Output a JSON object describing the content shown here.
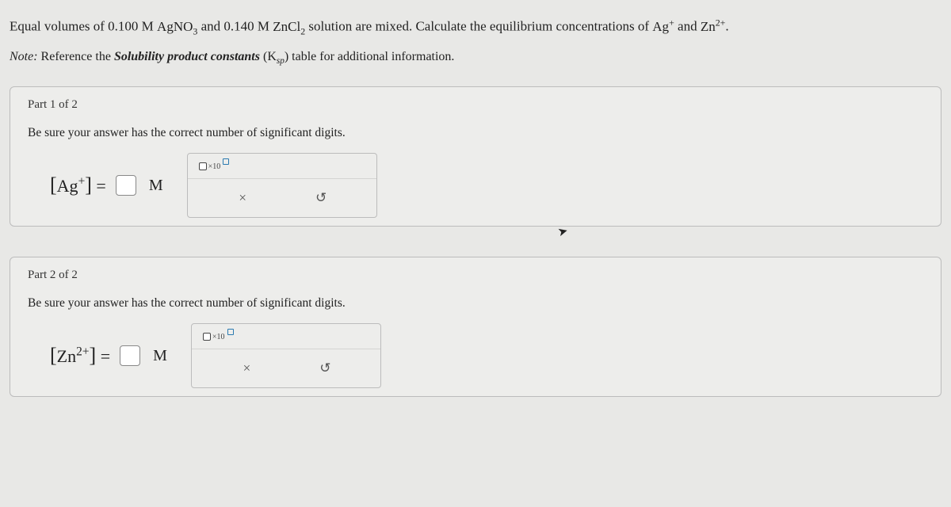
{
  "problem": {
    "prefix": "Equal volumes of ",
    "conc1": "0.100 M",
    "reagent1_a": "AgNO",
    "reagent1_sub": "3",
    "middle1": " and ",
    "conc2": "0.140 M",
    "reagent2_a": "ZnCl",
    "reagent2_sub": "2",
    "middle2": " solution are mixed. Calculate the equilibrium concentrations of ",
    "ion1": "Ag",
    "ion1_sup": "+",
    "and": " and ",
    "ion2": "Zn",
    "ion2_sup": "2+",
    "period": "."
  },
  "note": {
    "prefix": "Note:",
    "mid1": " Reference the ",
    "ref": "Solubility product constants",
    "k_open": " (K",
    "k_sub": "sp",
    "k_close": ")",
    "tail": " table for additional information."
  },
  "part1": {
    "label": "Part 1 of 2",
    "instruction": "Be sure your answer has the correct number of significant digits.",
    "ion": "Ag",
    "ion_sup": "+",
    "equals": " = ",
    "unit": "M",
    "toolbox_x10": "×10",
    "clear": "×",
    "reset": "↺"
  },
  "part2": {
    "label": "Part 2 of 2",
    "instruction": "Be sure your answer has the correct number of significant digits.",
    "ion": "Zn",
    "ion_sup": "2+",
    "equals": " = ",
    "unit": "M",
    "toolbox_x10": "×10",
    "clear": "×",
    "reset": "↺"
  }
}
